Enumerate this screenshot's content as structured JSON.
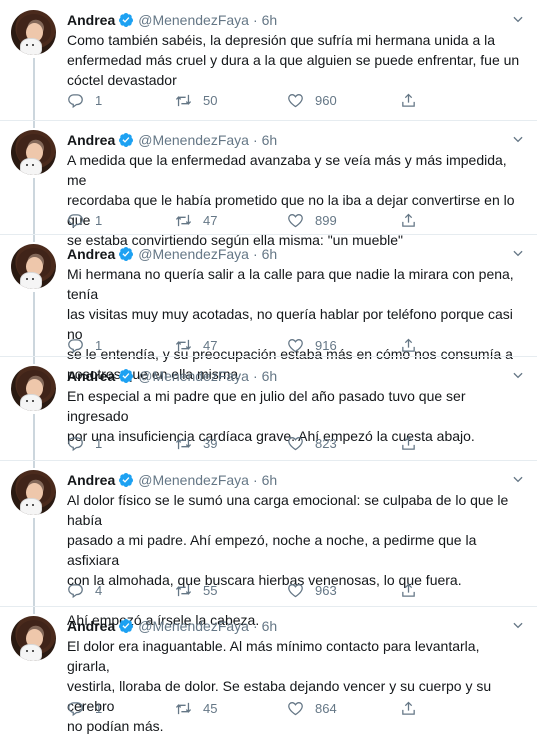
{
  "colors": {
    "verified": "#1da1f2",
    "secondary_text": "#657786",
    "thread_line": "#ccd6dd"
  },
  "icons": {
    "reply": "reply-icon",
    "retweet": "retweet-icon",
    "like": "heart-icon",
    "share": "share-icon",
    "verified": "verified-badge-icon",
    "more": "chevron-down-icon"
  },
  "tweets": [
    {
      "name": "Andrea",
      "handle": "@MenendezFaya",
      "separator": "·",
      "time": "6h",
      "text": "Como también sabéis, la depresión que sufría mi hermana unida a la\nenfermedad más cruel y dura a la que alguien se puede enfrentar, fue un\ncóctel devastador",
      "replies": "1",
      "retweets": "50",
      "likes": "960"
    },
    {
      "name": "Andrea",
      "handle": "@MenendezFaya",
      "separator": "·",
      "time": "6h",
      "text": "A medida que la enfermedad avanzaba y se veía más y más impedida, me\nrecordaba que le había prometido que no la iba a dejar convertirse en lo que\nse estaba convirtiendo según ella misma: \"un mueble\"",
      "replies": "1",
      "retweets": "47",
      "likes": "899"
    },
    {
      "name": "Andrea",
      "handle": "@MenendezFaya",
      "separator": "·",
      "time": "6h",
      "text": "Mi hermana no quería salir a la calle para que nadie la mirara con pena, tenía\nlas visitas muy muy acotadas, no quería hablar por teléfono porque casi no\nse le entendía, y su preocupación estaba más en cómo nos consumía a\nnosotros que en ella misma",
      "replies": "1",
      "retweets": "47",
      "likes": "916"
    },
    {
      "name": "Andrea",
      "handle": "@MenendezFaya",
      "separator": "·",
      "time": "6h",
      "text": "En especial a mi padre que en julio del año pasado tuvo que ser ingresado\npor una insuficiencia cardíaca grave. Ahí empezó la cuesta abajo.",
      "replies": "1",
      "retweets": "39",
      "likes": "823"
    },
    {
      "name": "Andrea",
      "handle": "@MenendezFaya",
      "separator": "·",
      "time": "6h",
      "text": "Al dolor físico se le sumó una carga emocional: se culpaba de lo que le había\npasado a mi padre. Ahí empezó, noche a noche, a pedirme que la asfixiara\ncon la almohada, que buscara hierbas venenosas, lo que fuera.\n\nAhí empezó a írsele la cabeza.",
      "replies": "4",
      "retweets": "55",
      "likes": "963"
    },
    {
      "name": "Andrea",
      "handle": "@MenendezFaya",
      "separator": "·",
      "time": "6h",
      "text": "El dolor era inaguantable. Al más mínimo contacto para levantarla, girarla,\nvestirla, lloraba de dolor. Se estaba dejando vencer y su cuerpo y su cerebro\nno podían más.",
      "replies": "1",
      "retweets": "45",
      "likes": "864"
    }
  ]
}
